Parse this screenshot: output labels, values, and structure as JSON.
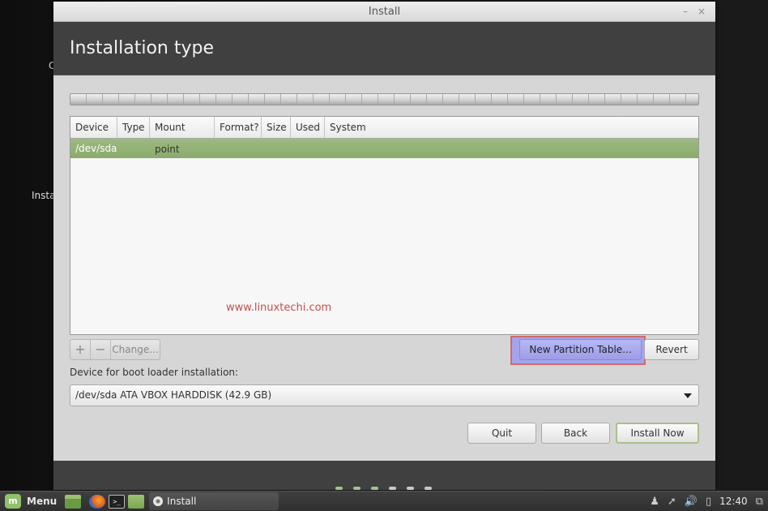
{
  "desktop": {
    "partial_texts": [
      "C",
      "Insta"
    ]
  },
  "window": {
    "title": "Install",
    "minimize_glyph": "–",
    "close_glyph": "×",
    "header_title": "Installation type"
  },
  "partition_table": {
    "columns": [
      "Device",
      "Type",
      "Mount point",
      "Format?",
      "Size",
      "Used",
      "System"
    ],
    "rows": [
      {
        "device": "/dev/sda",
        "selected": true
      }
    ],
    "watermark": "www.linuxtechi.com"
  },
  "toolbar": {
    "add_label": "+",
    "remove_label": "−",
    "change_label": "Change...",
    "new_partition_table_label": "New Partition Table...",
    "revert_label": "Revert"
  },
  "bootloader": {
    "label": "Device for boot loader installation:",
    "selected_value": "/dev/sda  ATA VBOX HARDDISK (42.9 GB)"
  },
  "nav_buttons": {
    "quit": "Quit",
    "back": "Back",
    "install_now": "Install Now"
  },
  "progress": {
    "completed_steps": 3,
    "total_steps": 6
  },
  "taskbar": {
    "menu_label": "Menu",
    "mint_glyph": "m",
    "terminal_glyph": ">_",
    "active_task": "Install",
    "clock": "12:40",
    "tray_icons": [
      "user-icon",
      "network-icon",
      "volume-icon",
      "battery-icon",
      "workspace-icon"
    ]
  },
  "colors": {
    "selected_row": "#8fae72",
    "highlight_border": "#d46a6a",
    "header_bg": "#404040",
    "accent_green": "#a7c28a"
  }
}
